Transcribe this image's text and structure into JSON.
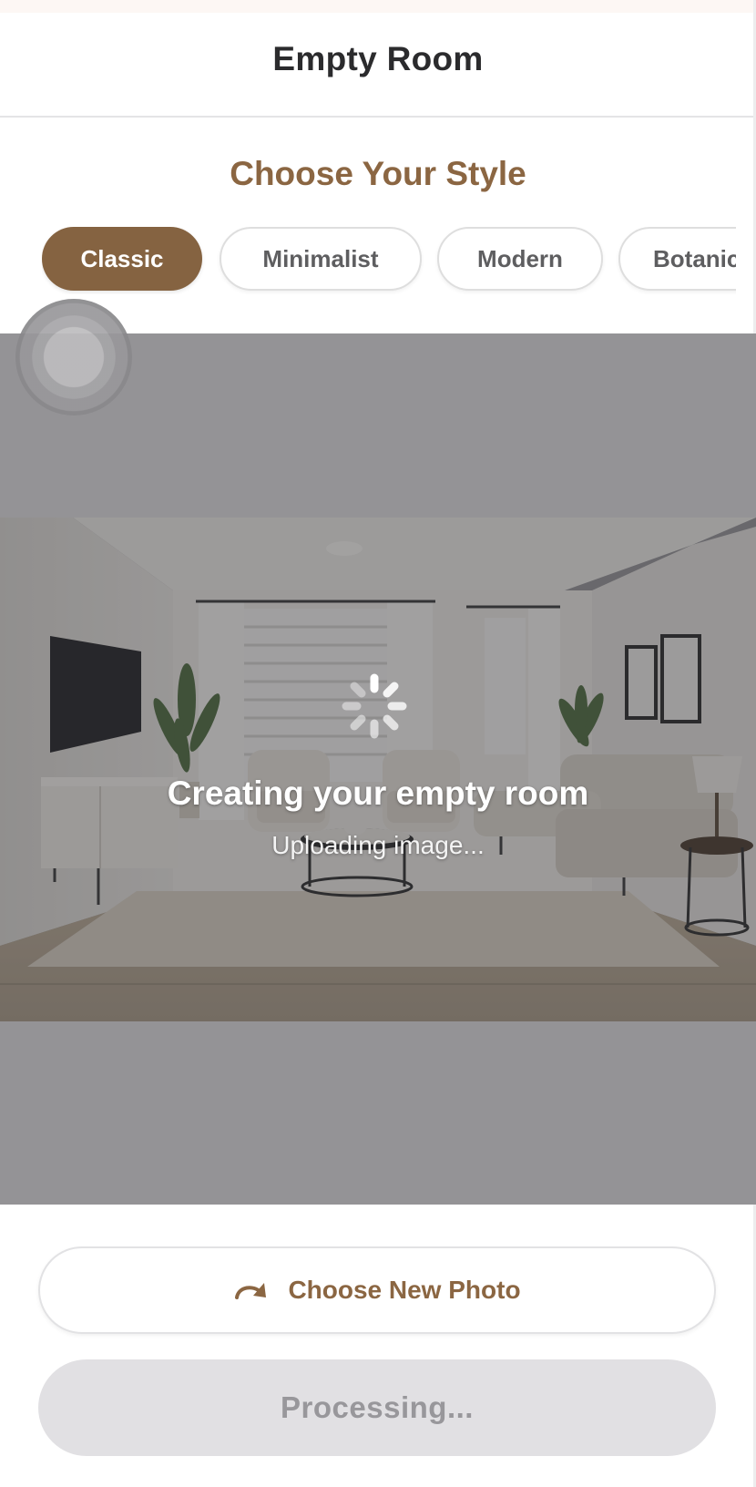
{
  "header": {
    "title": "Empty Room"
  },
  "style_picker": {
    "heading": "Choose Your Style",
    "options": [
      "Classic",
      "Minimalist",
      "Modern",
      "Botanical"
    ],
    "selected": "Classic"
  },
  "preview": {
    "image_description_icon": "living-room-photo",
    "status_title": "Creating your empty room",
    "status_subtitle": "Uploading image..."
  },
  "actions": {
    "choose_new_photo": "Choose New Photo",
    "processing": "Processing..."
  },
  "colors": {
    "accent": "#856341",
    "accent_text": "#8b6642",
    "overlay": "#949396",
    "disabled_bg": "#e1e0e3"
  }
}
